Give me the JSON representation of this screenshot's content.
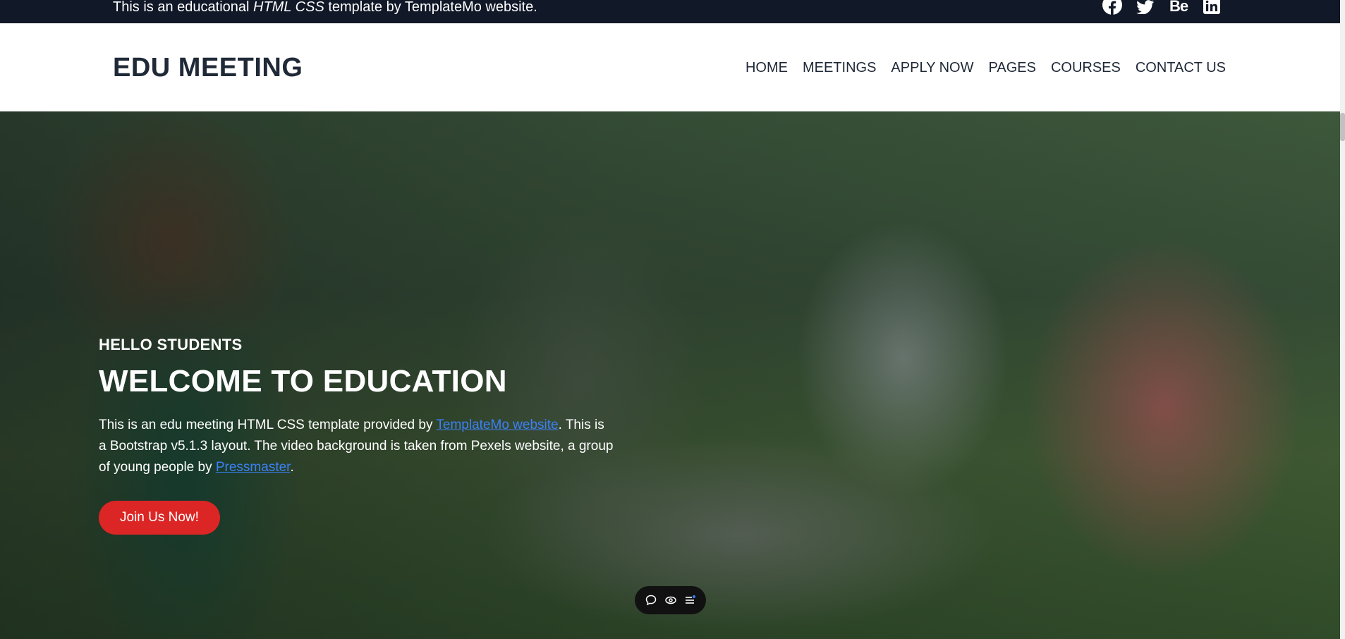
{
  "topbar": {
    "text_before": "This is an educational ",
    "text_emphasis": "HTML CSS",
    "text_after": " template by TemplateMo website.",
    "socials": [
      {
        "name": "facebook-icon"
      },
      {
        "name": "twitter-icon"
      },
      {
        "name": "behance-icon",
        "glyph": "Be"
      },
      {
        "name": "linkedin-icon"
      }
    ]
  },
  "header": {
    "logo": "EDU MEETING",
    "nav": [
      "HOME",
      "MEETINGS",
      "APPLY NOW",
      "PAGES",
      "COURSES",
      "CONTACT US"
    ]
  },
  "hero": {
    "kicker": "HELLO STUDENTS",
    "title": "WELCOME TO EDUCATION",
    "text_part1": "This is an edu meeting HTML CSS template provided by ",
    "link1": "TemplateMo website",
    "text_part2": ". This is a Bootstrap v5.1.3 layout. The video background is taken from Pexels website, a group of young people by ",
    "link2": "Pressmaster",
    "text_part3": ".",
    "button": "Join Us Now!"
  },
  "colors": {
    "topbar_bg": "#111827",
    "text_dark": "#1f2937",
    "accent_red": "#dc2626",
    "link_blue": "#3b82f6"
  },
  "mini_toolbar": {
    "icons": [
      "comment-icon",
      "eye-icon",
      "list-icon"
    ]
  }
}
